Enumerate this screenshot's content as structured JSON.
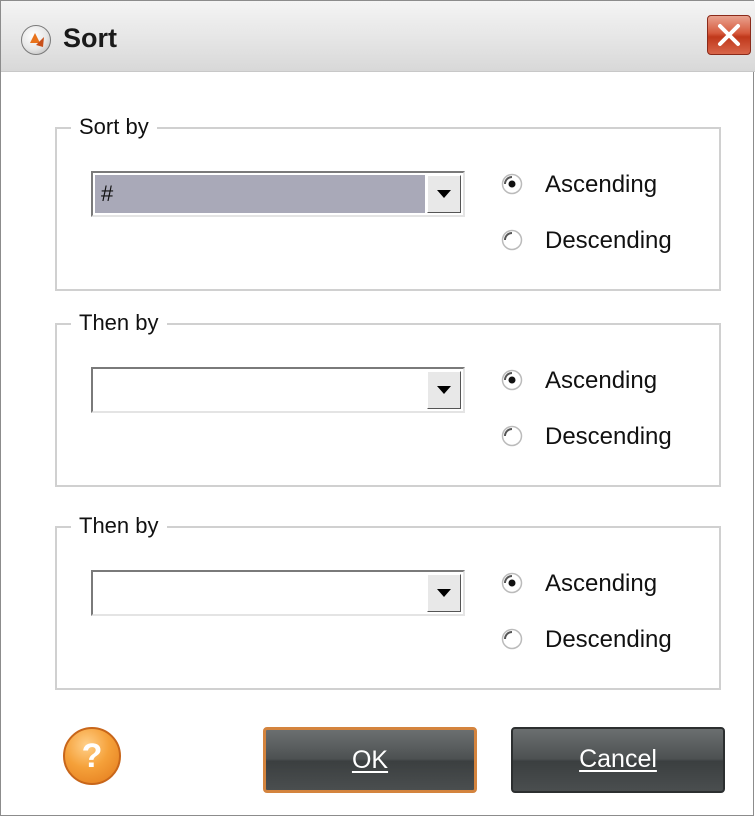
{
  "window": {
    "title": "Sort",
    "app_icon": "app-logo-icon",
    "close_icon": "close-icon"
  },
  "groups": [
    {
      "legend": "Sort by",
      "field_value": "#",
      "ascending_label": "Ascending",
      "descending_label": "Descending",
      "selected_order": "Ascending"
    },
    {
      "legend": "Then by",
      "field_value": "",
      "ascending_label": "Ascending",
      "descending_label": "Descending",
      "selected_order": "Ascending"
    },
    {
      "legend": "Then by",
      "field_value": "",
      "ascending_label": "Ascending",
      "descending_label": "Descending",
      "selected_order": "Ascending"
    }
  ],
  "footer": {
    "help_icon": "help-icon",
    "help_glyph": "?",
    "ok_label": "OK",
    "cancel_label": "Cancel"
  },
  "colors": {
    "ok_border": "#d4843e",
    "close_red": "#c0381b",
    "help_orange": "#f5a13a"
  }
}
